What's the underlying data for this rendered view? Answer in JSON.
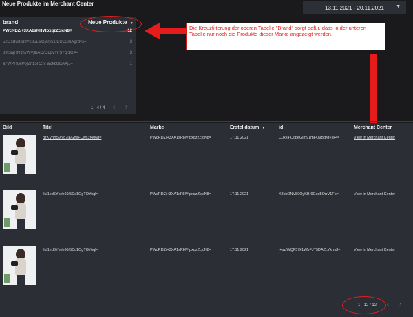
{
  "header": {
    "title": "Neue Produkte im Merchant Center",
    "date_range": "13.11.2021 - 20.11.2021"
  },
  "brand_table": {
    "col_brand": "brand",
    "col_count": "Neue Produkte",
    "rows": [
      {
        "brand": "PWcRDZ/+3XA1sRHVtpxqzZcjcN8=",
        "count": "12"
      },
      {
        "brand": "52GsBuXwl9Vc35LwGjaryk1fBUC3mAgrdvs=",
        "count": "3"
      },
      {
        "brand": "89t3ajHhRhvWVjlbAO/OLpvYnS7qf1GA=",
        "count": "3"
      },
      {
        "brand": "a7WPH0eP0jZn15RZnFaZkbbIxAXjJ=",
        "count": "1"
      }
    ],
    "pagination": "1 - 4 / 4"
  },
  "callout": {
    "text": "Die Kreuzfilterung der oberen Tabelle \"Brand\" sorgt dafür, dass in der unteren Tabelle nur noch die Produkte dieser Marke angezeigt werden."
  },
  "product_table": {
    "columns": [
      "Bild",
      "Titel",
      "Marke",
      "Erstelldatum",
      "id",
      "Merchant Center"
    ],
    "rows": [
      {
        "titel": "qzKVhY59/vd7lEGhxFCwx3f406g=",
        "marke": "PWcRDZ/+3XA1sRHVtpxqzZcjcN8=",
        "datum": "17.11.2021",
        "id": "C0xk4lOcbeGjm91mFO9BdKt+xk4=",
        "mc": "View in Merchant Center"
      },
      {
        "titel": "llui1ed6Ykeh60/5Dc1OgTl9Yoql=",
        "marke": "PWcRDZ/+3XA1sRHVtpxqzZcjcN8=",
        "datum": "17.11.2021",
        "id": "X8ckONV50OyKBr9Gxd5OrrV1Fo=",
        "mc": "View in Merchant Center"
      },
      {
        "titel": "llui1ed6Ykeh60/5Dc1OgTl9Yoql=",
        "marke": "PWcRDZ/+3XA1sRHVtpxqzZcjcN8=",
        "datum": "17.11.2021",
        "id": "j+uzlWQF57k1WbFJT5DAZLYkmdI=",
        "mc": "View in Merchant Center"
      }
    ],
    "pagination": "1 - 12 / 12"
  },
  "colors": {
    "annotation_red": "#e02020",
    "panel_bg": "#2b2e35"
  }
}
